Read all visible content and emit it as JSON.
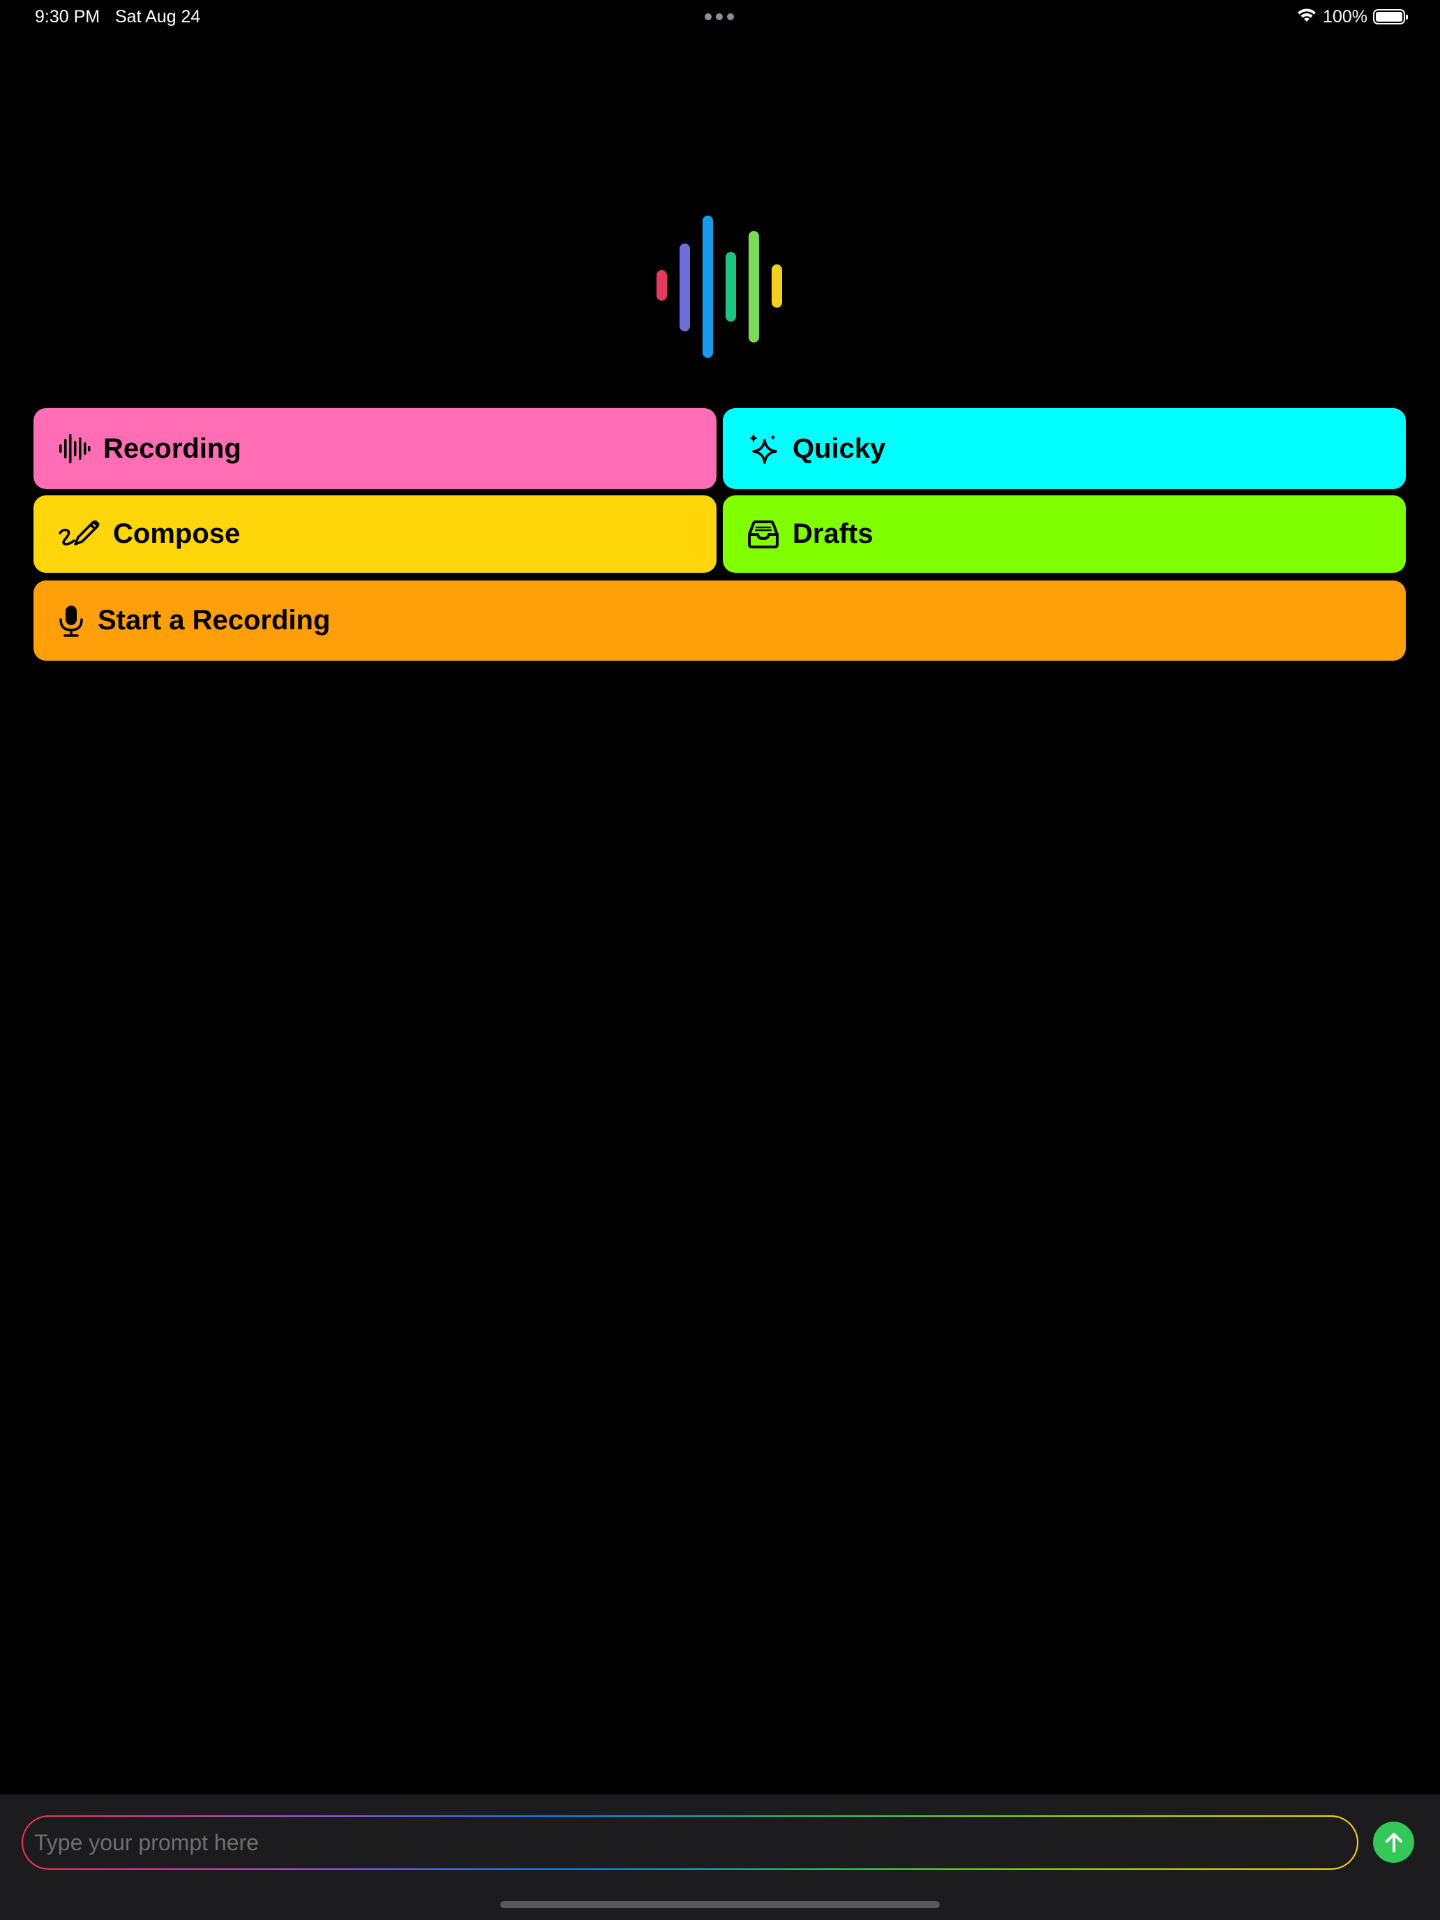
{
  "status_bar": {
    "time": "9:30 PM",
    "date": "Sat Aug 24",
    "battery_percent": "100%",
    "battery_level": 1.0,
    "wifi_icon": "wifi-icon"
  },
  "logo": {
    "icon": "waveform-logo",
    "bar_colors": [
      "#e5395f",
      "#6e6ed8",
      "#1a9bea",
      "#1ec483",
      "#7ed957",
      "#f0d11f"
    ]
  },
  "actions": {
    "recording": {
      "label": "Recording",
      "icon": "waveform-icon",
      "color": "#ff6eb4"
    },
    "quicky": {
      "label": "Quicky",
      "icon": "sparkles-icon",
      "color": "#00ffff"
    },
    "compose": {
      "label": "Compose",
      "icon": "pencil-scribble-icon",
      "color": "#ffd60a"
    },
    "drafts": {
      "label": "Drafts",
      "icon": "tray-icon",
      "color": "#7fff00"
    },
    "start_recording": {
      "label": "Start a Recording",
      "icon": "microphone-icon",
      "color": "#ff9f0a"
    }
  },
  "prompt": {
    "placeholder": "Type your prompt here",
    "value": "",
    "send_icon": "arrow-up-icon",
    "send_color": "#34c759"
  }
}
